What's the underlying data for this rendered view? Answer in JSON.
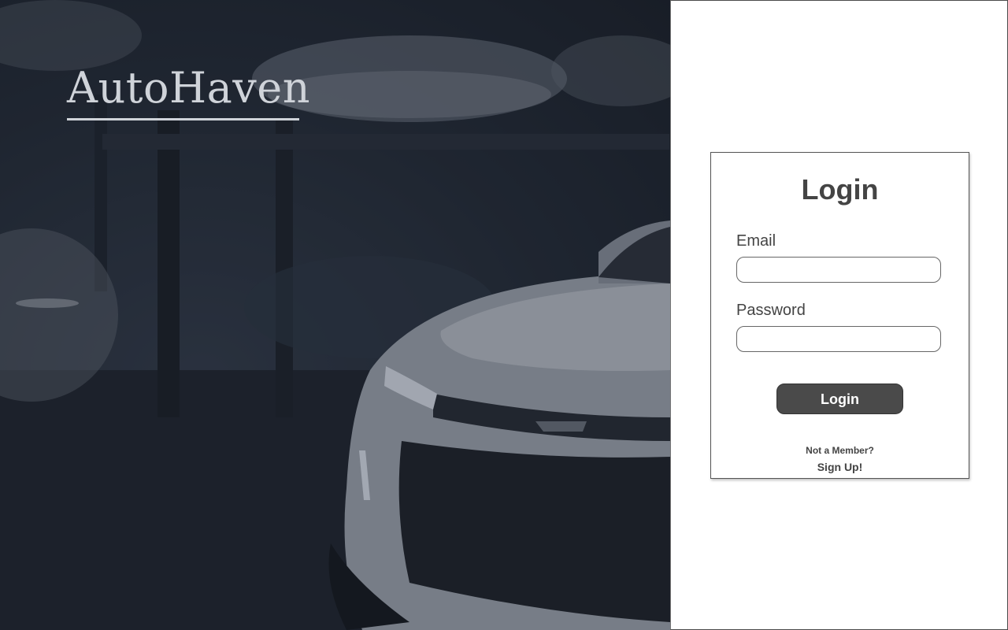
{
  "brand": {
    "name": "AutoHaven"
  },
  "login_form": {
    "title": "Login",
    "email_label": "Email",
    "email_value": "",
    "password_label": "Password",
    "password_value": "",
    "submit_label": "Login",
    "not_member_text": "Not a Member?",
    "signup_link": "Sign Up!"
  },
  "colors": {
    "hero_overlay": "#1f2631",
    "button_bg": "#4a4a4a",
    "text_dark": "#444444"
  }
}
